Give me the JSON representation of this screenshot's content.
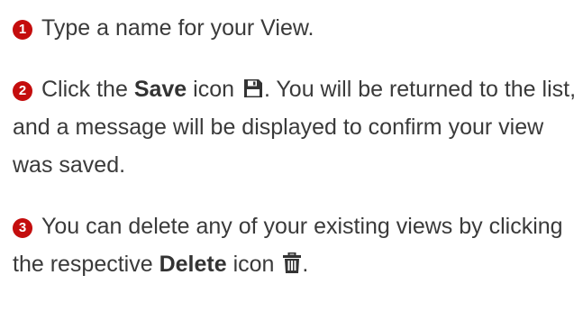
{
  "colors": {
    "text": "#3a3a3a",
    "marker": "#c40d0d",
    "icon": "#333333"
  },
  "steps": [
    {
      "marker": "1",
      "text": "Type a name for your View."
    },
    {
      "marker": "2",
      "text_before": "Click the ",
      "bold": "Save",
      "text_middle": " icon ",
      "icon": "save-icon",
      "text_after": ". You will be returned to the list, and a message will be displayed to confirm your view was saved."
    },
    {
      "marker": "3",
      "text_before": "You can delete any of your existing views by clicking the respective ",
      "bold": "Delete",
      "text_middle": " icon ",
      "icon": "trash-icon",
      "text_after": "."
    }
  ]
}
